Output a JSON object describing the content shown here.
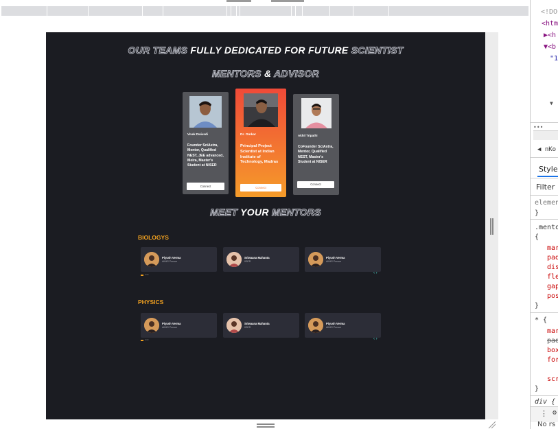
{
  "page": {
    "heading_line1": {
      "part1": "OUR TEAMS",
      "part2": "FULLY DEDICATED FOR FUTURE",
      "part3": "SCIENTIST"
    },
    "heading_line2": {
      "part1": "MENTORS",
      "part2": "&",
      "part3": "ADVISOR"
    },
    "heading_meet": {
      "part1": "MEET",
      "part2": "YOUR",
      "part3": "MENTORS"
    }
  },
  "mentor_cards": [
    {
      "name": "Vivek Dwivedi",
      "description": "Founder SciAstra, Mentor, Qualified NEST, JEE advanced, Meira, Master's Student at NISER",
      "button": "Connect",
      "bg": "#55565b"
    },
    {
      "name": "Dr. Omkar",
      "description": "Principal Project Scientist at Indian Institute of Technology, Madras",
      "button": "Connect",
      "bg": "#f26a32"
    },
    {
      "name": "Akhil Tripathi",
      "description": "CoFounder SciAstra, Mentor, Qualified NEST, Master's Student at NISER",
      "button": "Connect",
      "bg": "#55565b"
    }
  ],
  "categories": [
    {
      "title": "BIOLOGYS",
      "mentors": [
        {
          "name": "Piyush Verma",
          "role": "AIIMS Pursue"
        },
        {
          "name": "Sriwaana Mahanta",
          "role": "IISER"
        },
        {
          "name": "Piyush Verma",
          "role": "AIIMS Pursue"
        }
      ]
    },
    {
      "title": "PHYSICS",
      "mentors": [
        {
          "name": "Piyush Verma",
          "role": "AIIMS Pursue"
        },
        {
          "name": "Sriwaana Mahanta",
          "role": "IISER"
        },
        {
          "name": "Piyush Verma",
          "role": "AIIMS Pursue"
        }
      ]
    }
  ],
  "devtools": {
    "lines_top": [
      "<!DOC",
      "<htm",
      "▶<h",
      "▼<b",
      "\"1",
      "▼"
    ],
    "tab_label": "◀ nKo",
    "styles_tab": "Styles",
    "filter_placeholder": "Filter",
    "rule1_selector": "elemen",
    "rule1_close": "}",
    "rule2_selector": ".mento",
    "rule2_open": "{",
    "rule2_props": [
      "mar",
      "pad",
      "dis",
      "fle",
      "gap",
      "pos"
    ],
    "rule2_close": "}",
    "rule3_selector": "* {",
    "rule3_props": [
      "mar",
      "pad",
      "box",
      "for"
    ],
    "rule3_extra": "scr",
    "rule3_close": "}",
    "rule4_selector": "div {",
    "bottom_text": "No rs"
  },
  "colors": {
    "accent_orange": "#f0a020",
    "viewport_bg": "#1b1c22",
    "card_grey": "#55565b",
    "card_orange": "#f26a32"
  }
}
